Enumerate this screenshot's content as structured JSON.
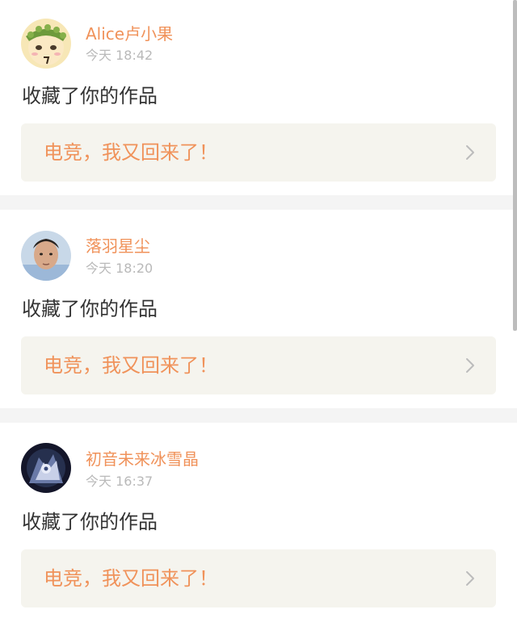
{
  "notifications": [
    {
      "avatar_icon": "avatar-anime-girl-wreath-icon",
      "username": "Alice卢小果",
      "time": "今天 18:42",
      "action": "收藏了你的作品",
      "work_title": "电竞，我又回来了！"
    },
    {
      "avatar_icon": "avatar-photo-person-icon",
      "username": "落羽星尘",
      "time": "今天 18:20",
      "action": "收藏了你的作品",
      "work_title": "电竞，我又回来了！"
    },
    {
      "avatar_icon": "avatar-dark-anime-character-icon",
      "username": "初音未来冰雪晶",
      "time": "今天 16:37",
      "action": "收藏了你的作品",
      "work_title": "电竞，我又回来了！"
    }
  ],
  "colors": {
    "accent": "#f0925a",
    "time_text": "#b9b9b9",
    "body_text": "#333333",
    "work_box_bg": "#f5f4ee",
    "divider_bg": "#f4f4f4"
  }
}
